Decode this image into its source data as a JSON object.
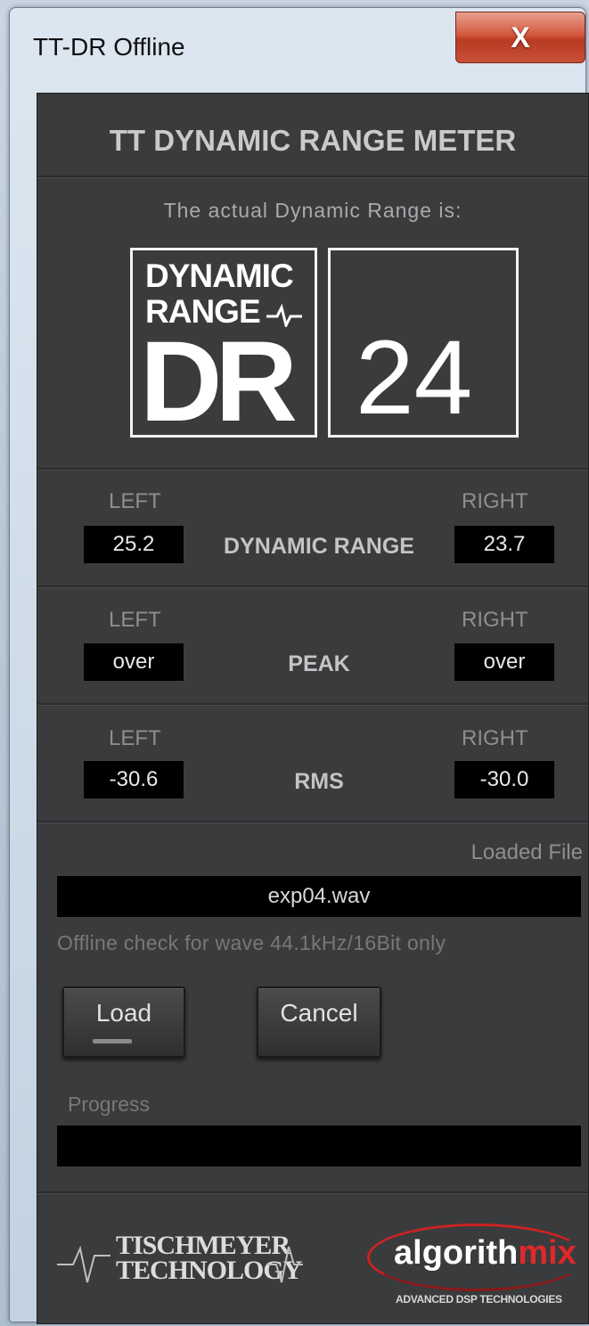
{
  "window": {
    "title": "TT-DR Offline",
    "close_glyph": "X"
  },
  "meter": {
    "title": "TT DYNAMIC RANGE METER",
    "subtitle": "The actual Dynamic Range is:",
    "logo": {
      "line1": "DYNAMIC",
      "line2": "RANGE",
      "line3": "DR"
    },
    "dr_value": "24"
  },
  "rows": [
    {
      "left_label": "LEFT",
      "right_label": "RIGHT",
      "name": "DYNAMIC RANGE",
      "left_value": "25.2",
      "right_value": "23.7"
    },
    {
      "left_label": "LEFT",
      "right_label": "RIGHT",
      "name": "PEAK",
      "left_value": "over",
      "right_value": "over"
    },
    {
      "left_label": "LEFT",
      "right_label": "RIGHT",
      "name": "RMS",
      "left_value": "-30.6",
      "right_value": "-30.0"
    }
  ],
  "file": {
    "label": "Loaded File",
    "name": "exp04.wav",
    "note": "Offline check for wave 44.1kHz/16Bit only"
  },
  "buttons": {
    "load_label": "Load",
    "cancel_label": "Cancel"
  },
  "progress": {
    "label": "Progress",
    "fraction": 0
  },
  "footer": {
    "tt_line1": "TISCHMEYER",
    "tt_line2": "TECHNOLOGY",
    "am_part1": "algorith",
    "am_part2": "mix",
    "am_tagline": "ADVANCED DSP TECHNOLOGIES"
  }
}
